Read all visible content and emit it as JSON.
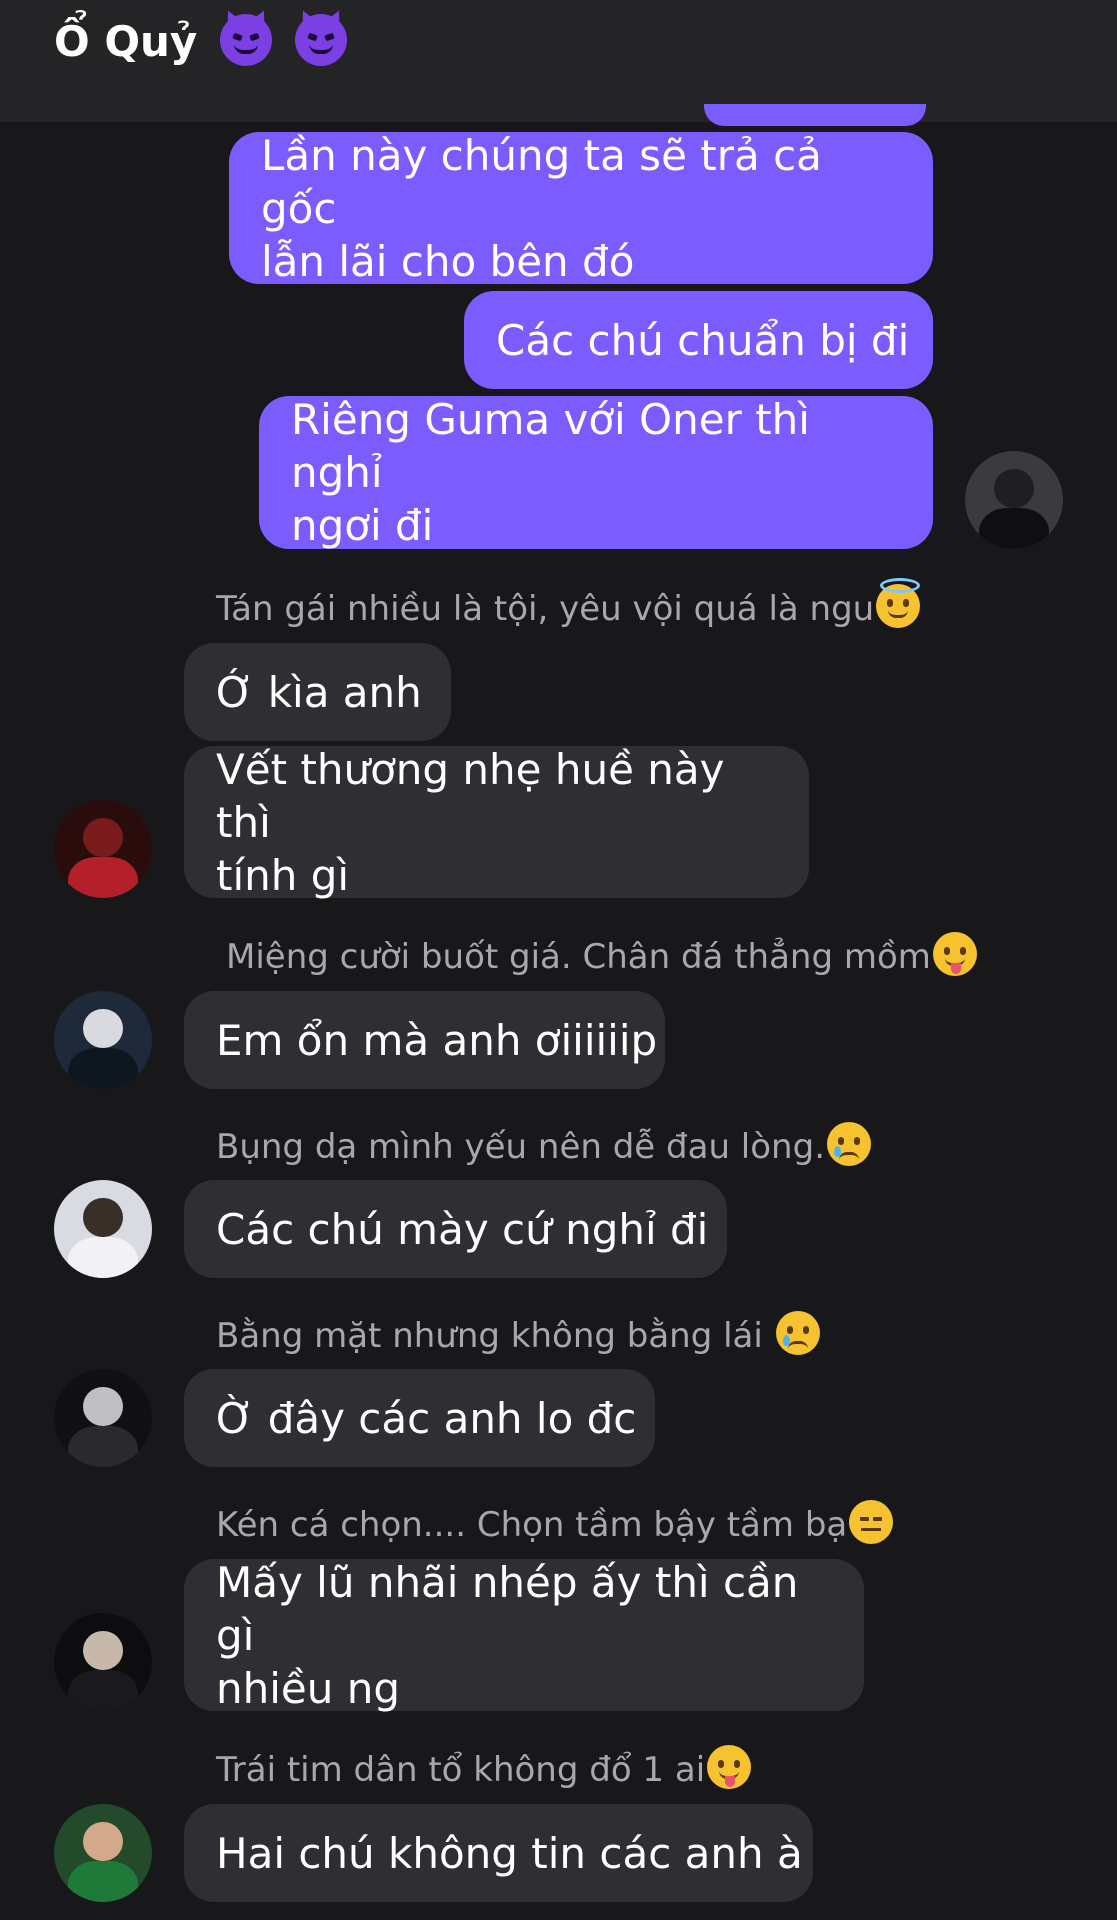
{
  "header": {
    "title": "Ổ Quỷ",
    "emojis": [
      "smiling-devil-icon",
      "smiling-devil-icon"
    ]
  },
  "messages": {
    "out": [
      "Lần này chúng ta sẽ trả cả gốc\nlẫn lãi cho bên đó",
      "Các chú chuẩn bị đi",
      "Riêng Guma với Oner thì nghỉ\nngơi đi"
    ],
    "in": [
      {
        "sender": "Tán gái nhiều là tội, yêu vội quá là ngu",
        "sender_emoji": "halo-emoji-icon",
        "bubbles": [
          "Ớ kìa anh",
          "Vết thương nhẹ huề này thì\ntính gì"
        ]
      },
      {
        "sender": "Miệng cười buốt giá. Chân đá thẳng mồm",
        "sender_emoji": "winking-tongue-emoji-icon",
        "bubbles": [
          "Em ổn mà anh ơiiiiiip"
        ]
      },
      {
        "sender": "Bụng dạ mình yếu nên dễ đau lòng.",
        "sender_emoji": "crying-emoji-icon",
        "bubbles": [
          "Các chú mày cứ nghỉ đi"
        ]
      },
      {
        "sender": "Bằng mặt nhưng không bằng lái",
        "sender_emoji": "sad-tear-emoji-icon",
        "bubbles": [
          "Ờ đây các anh lo đc"
        ]
      },
      {
        "sender": "Kén cá chọn.... Chọn tầm bậy tầm bạ",
        "sender_emoji": "expressionless-emoji-icon",
        "bubbles": [
          "Mấy lũ nhãi nhép ấy thì cần gì\nnhiều ng"
        ]
      },
      {
        "sender": "Trái tim dân tổ không đổ 1 ai",
        "sender_emoji": "winking-tongue-emoji-icon",
        "bubbles": [
          "Hai chú không tin các anh à"
        ]
      }
    ]
  },
  "colors": {
    "background": "#18181b",
    "header": "#242426",
    "outgoing_bubble": "#7b5cff",
    "incoming_bubble": "#2f2f33",
    "sender_name": "#a7a7ad"
  }
}
